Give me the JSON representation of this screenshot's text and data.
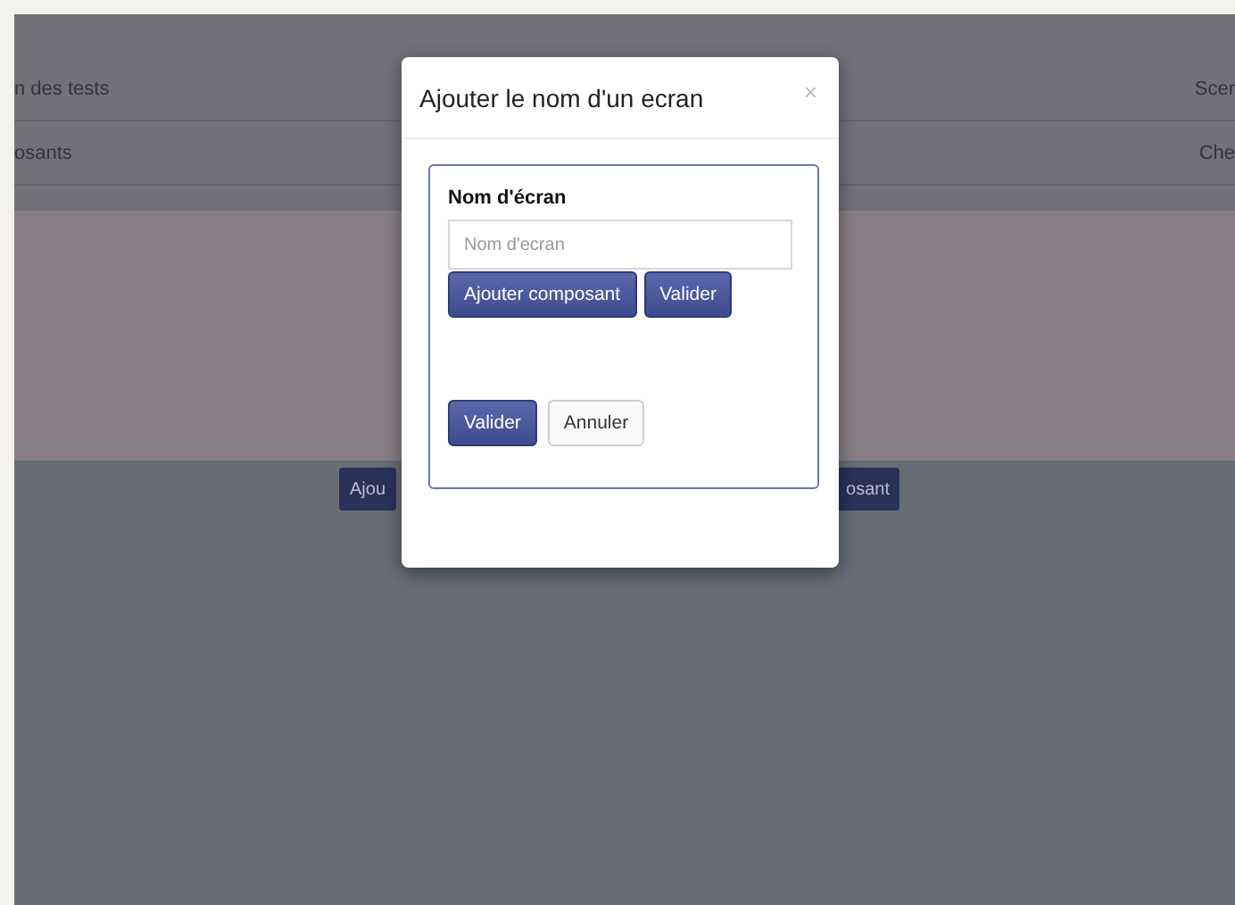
{
  "background": {
    "nav_rows": [
      {
        "left": "n des tests",
        "right": "Scer"
      },
      {
        "left": "osants",
        "right": "Che"
      }
    ],
    "buttons": [
      "Ajou",
      "osant"
    ]
  },
  "modal": {
    "title": "Ajouter le nom d'un ecran",
    "close": "×",
    "field": {
      "label": "Nom d'écran",
      "placeholder": "Nom d'ecran"
    },
    "field_buttons": [
      {
        "label": "Ajouter composant",
        "kind": "primary"
      },
      {
        "label": "Valider",
        "kind": "primary"
      }
    ],
    "footer_buttons": [
      {
        "label": "Valider",
        "kind": "primary"
      },
      {
        "label": "Annuler",
        "kind": "default"
      }
    ]
  }
}
